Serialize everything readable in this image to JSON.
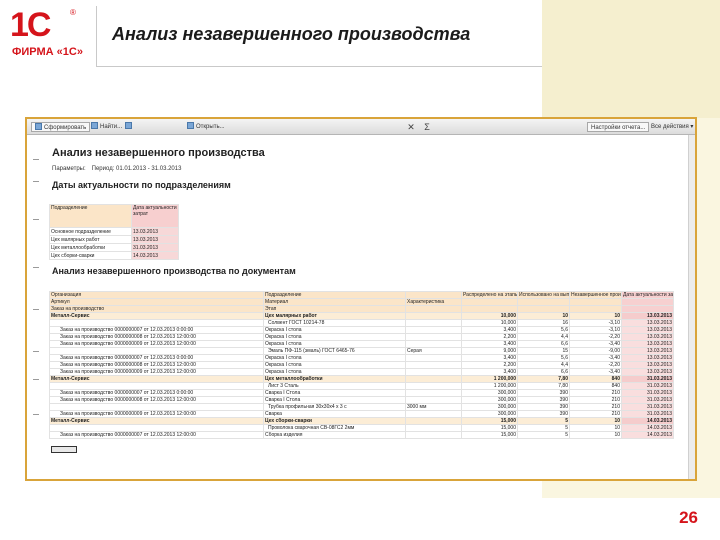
{
  "slide": {
    "logo_main": "1С",
    "logo_reg": "®",
    "logo_firm": "ФИРМА «1С»",
    "title": "Анализ незавершенного производства",
    "page_number": "26",
    "colors": {
      "brand_red": "#d5141b",
      "frame": "#d9a43a",
      "header_orange": "#fbe5c8",
      "header_pink": "#f7d0d0"
    }
  },
  "toolbar": {
    "generate": "Сформировать",
    "find": "Найти...",
    "btn3": "",
    "output": "Открыть...",
    "settings": "Настройки отчета...",
    "all_actions": "Все действия ▾",
    "icons": [
      "report-icon",
      "search-icon",
      "print-icon",
      "expand-icon",
      "close-icon",
      "sum-icon"
    ]
  },
  "report": {
    "title": "Анализ незавершенного производства",
    "params_label": "Параметры:",
    "params_value": "Период: 01.01.2013 - 31.03.2013",
    "section1": "Даты актуальности по подразделениям",
    "section2": "Анализ незавершенного производства по документам"
  },
  "table1": {
    "headers": [
      "Подразделение",
      "Дата актуальности затрат"
    ],
    "rows": [
      [
        "Основное подразделение",
        "13.03.2013"
      ],
      [
        "Цех малярных работ",
        "13.03.2013"
      ],
      [
        "Цех металлообработки",
        "31.03.2013"
      ],
      [
        "Цех сборки-сварки",
        "14.03.2013"
      ]
    ]
  },
  "table2": {
    "headers": [
      [
        "Организация",
        "Подразделение",
        "",
        "Распределено на этапы производства",
        "Использовано на выпуск",
        "Незавершенное производство",
        "Дата актуальности затрат"
      ],
      [
        "Артикул",
        "Материал",
        "Характеристика",
        "",
        "",
        "",
        ""
      ],
      [
        "Заказ на производство",
        "Этап",
        "",
        "",
        "",
        "",
        ""
      ]
    ],
    "rows": [
      {
        "type": "grp",
        "cells": [
          "Металл-Сервис",
          "Цех малярных работ",
          "",
          "10,000",
          "10",
          "10",
          "13.03.2013"
        ]
      },
      {
        "type": "r",
        "cells": [
          "",
          "Солвент ГОСТ 10214-78",
          "",
          "10,000",
          "16",
          "-3,10",
          "13.03.2013"
        ]
      },
      {
        "type": "r",
        "cells": [
          "Заказ на производство 0000000007 от 12.03.2013 0:00:00",
          "Окраска I стола",
          "",
          "3,400",
          "5,6",
          "-3,10",
          "13.03.2013"
        ]
      },
      {
        "type": "r",
        "cells": [
          "Заказ на производство 0000000008 от 12.03.2013 12:00:00",
          "Окраска I стола",
          "",
          "2,200",
          "4,4",
          "-2,20",
          "13.03.2013"
        ]
      },
      {
        "type": "r",
        "cells": [
          "Заказ на производство 0000000009 от 12.03.2013 12:00:00",
          "Окраска I стола",
          "",
          "3,400",
          "6,6",
          "-3,40",
          "13.03.2013"
        ]
      },
      {
        "type": "r",
        "cells": [
          "",
          "Эмаль ПФ-115 (эмаль) ГОСТ 6465-76",
          "Серая",
          "9,000",
          "15",
          "-9,00",
          "13.03.2013"
        ]
      },
      {
        "type": "r",
        "cells": [
          "Заказ на производство 0000000007 от 12.03.2013 0:00:00",
          "Окраска I стола",
          "",
          "3,400",
          "5,6",
          "-3,40",
          "13.03.2013"
        ]
      },
      {
        "type": "r",
        "cells": [
          "Заказ на производство 0000000008 от 12.03.2013 12:00:00",
          "Окраска I стола",
          "",
          "2,200",
          "4,4",
          "-2,20",
          "13.03.2013"
        ]
      },
      {
        "type": "r",
        "cells": [
          "Заказ на производство 0000000009 от 12.03.2013 12:00:00",
          "Окраска I стола",
          "",
          "3,400",
          "6,6",
          "-3,40",
          "13.03.2013"
        ]
      },
      {
        "type": "grp",
        "cells": [
          "Металл-Сервис",
          "Цех металлообработки",
          "",
          "1 200,000",
          "7,80",
          "840",
          "31.03.2013"
        ]
      },
      {
        "type": "r",
        "cells": [
          "",
          "Лист 3 Сталь",
          "",
          "1 200,000",
          "7,80",
          "840",
          "31.03.2013"
        ]
      },
      {
        "type": "r",
        "cells": [
          "Заказ на производство 0000000007 от 12.03.2013 0:00:00",
          "Сварка I Стола",
          "",
          "300,000",
          "390",
          "210",
          "31.03.2013"
        ]
      },
      {
        "type": "r",
        "cells": [
          "Заказ на производство 0000000008 от 12.03.2013 12:00:00",
          "Сварка I Стола",
          "",
          "300,000",
          "390",
          "210",
          "31.03.2013"
        ]
      },
      {
        "type": "r",
        "cells": [
          "",
          "Трубка профильная 30x30x4 x 3 с",
          "3000 мм",
          "300,000",
          "390",
          "210",
          "31.03.2013"
        ]
      },
      {
        "type": "r",
        "cells": [
          "Заказ на производство 0000000009 от 12.03.2013 12:00:00",
          "Сварка",
          "",
          "300,000",
          "390",
          "210",
          "31.03.2013"
        ]
      },
      {
        "type": "grp",
        "cells": [
          "Металл-Сервис",
          "Цех сборки-сварки",
          "",
          "15,000",
          "5",
          "10",
          "14.03.2013"
        ]
      },
      {
        "type": "r",
        "cells": [
          "",
          "Проволока сварочная СВ-08ГС2 2мм",
          "",
          "15,000",
          "5",
          "10",
          "14.03.2013"
        ]
      },
      {
        "type": "r",
        "cells": [
          "Заказ на производство 0000000007 от 12.03.2013 12:00:00",
          "Сборка изделия",
          "",
          "15,000",
          "5",
          "10",
          "14.03.2013"
        ]
      }
    ]
  }
}
